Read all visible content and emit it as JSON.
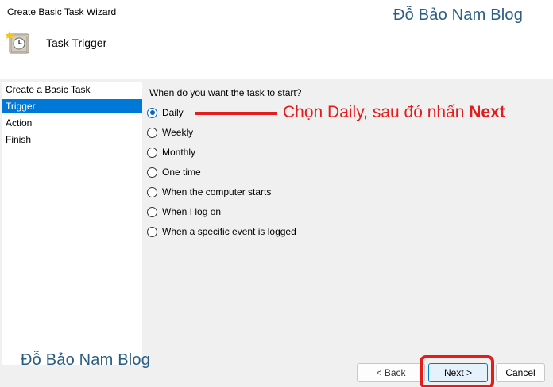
{
  "window": {
    "title": "Create Basic Task Wizard"
  },
  "header": {
    "page_title": "Task Trigger",
    "icon": "clock-icon"
  },
  "watermark": {
    "top": "Đỗ Bảo Nam Blog",
    "bottom": "Đỗ Bảo Nam Blog",
    "color": "#2a5d84"
  },
  "nav": {
    "items": [
      {
        "label": "Create a Basic Task",
        "selected": false
      },
      {
        "label": "Trigger",
        "selected": true
      },
      {
        "label": "Action",
        "selected": false
      },
      {
        "label": "Finish",
        "selected": false
      }
    ]
  },
  "trigger": {
    "question": "When do you want the task to start?",
    "options": [
      {
        "label": "Daily",
        "checked": true
      },
      {
        "label": "Weekly",
        "checked": false
      },
      {
        "label": "Monthly",
        "checked": false
      },
      {
        "label": "One time",
        "checked": false
      },
      {
        "label": "When the computer starts",
        "checked": false
      },
      {
        "label": "When I log on",
        "checked": false
      },
      {
        "label": "When a specific event is logged",
        "checked": false
      }
    ]
  },
  "annotation": {
    "text": "Chọn Daily, sau đó nhấn ",
    "emphasis": "Next",
    "color": "#e51c1c"
  },
  "buttons": {
    "back": "< Back",
    "next": "Next >",
    "cancel": "Cancel"
  },
  "colors": {
    "selection": "#0078d7",
    "highlight": "#e51c1c"
  }
}
